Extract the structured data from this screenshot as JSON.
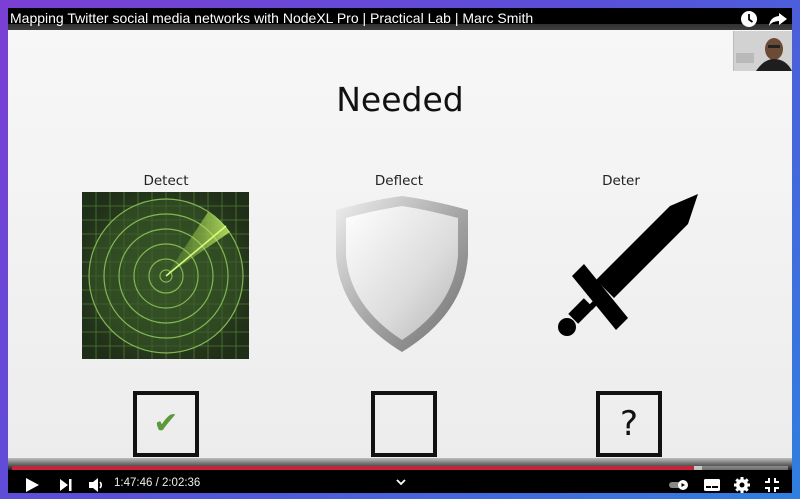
{
  "video": {
    "title": "Mapping Twitter social media networks with NodeXL Pro | Practical Lab | Marc Smith"
  },
  "slide": {
    "heading": "Needed",
    "columns": [
      {
        "label": "Detect",
        "art": "radar-image",
        "box_glyph": "✔",
        "box_state": "checked"
      },
      {
        "label": "Deflect",
        "art": "shield-image",
        "box_glyph": "",
        "box_state": "empty"
      },
      {
        "label": "Deter",
        "art": "sword-image",
        "box_glyph": "?",
        "box_state": "question"
      }
    ]
  },
  "player": {
    "current_time": "1:47:46",
    "duration": "2:02:36",
    "time_display": "1:47:46 / 2:02:36",
    "progress": 0.879,
    "buffered": 0.01,
    "accent_color": "#c3253a",
    "icons": [
      "watch-later-icon",
      "share-icon",
      "play-icon",
      "next-icon",
      "volume-icon",
      "chevron-up-icon",
      "autoplay-toggle-icon",
      "subtitles-icon",
      "settings-icon",
      "exit-fullscreen-icon"
    ]
  }
}
